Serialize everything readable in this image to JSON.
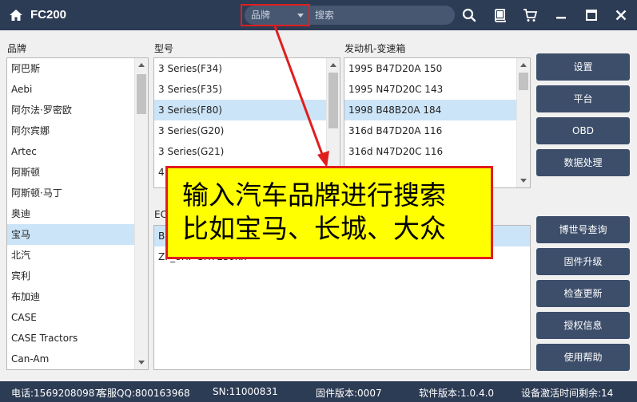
{
  "app": {
    "title": "FC200"
  },
  "search": {
    "brand_dropdown": "品牌",
    "placeholder": "搜索"
  },
  "panels": {
    "brand": {
      "label": "品牌",
      "items": [
        "阿巴斯",
        "Aebi",
        "阿尔法·罗密欧",
        "阿尔宾娜",
        "Artec",
        "阿斯顿",
        "阿斯顿·马丁",
        "奥迪",
        "宝马",
        "北汽",
        "宾利",
        "布加迪",
        "CASE",
        "CASE Tractors",
        "Can-Am"
      ],
      "selected_index": 8
    },
    "model": {
      "label": "型号",
      "items": [
        "3 Series(F34)",
        "3 Series(F35)",
        "3 Series(F80)",
        "3 Series(G20)",
        "3 Series(G21)",
        "4",
        "4"
      ],
      "selected_index": 2
    },
    "engine": {
      "label": "发动机-变速箱",
      "items": [
        "1995 B47D20A 150",
        "1995 N47D20C 143",
        "1998 B48B20A 184",
        "316d B47D20A 116",
        "316d N47D20C 116"
      ],
      "selected_index": 2
    },
    "ecu": {
      "label": "EC",
      "items": [
        "B",
        "ZF_8HP-SH7259xx"
      ],
      "selected_index": 0
    }
  },
  "side_buttons_top": [
    "设置",
    "平台",
    "OBD",
    "数据处理"
  ],
  "side_buttons_bottom": [
    "博世号查询",
    "固件升级",
    "检查更新",
    "授权信息",
    "使用帮助"
  ],
  "status": {
    "phone": "电话:15692080987",
    "qq": "客服QQ:800163968",
    "sn": "SN:11000831",
    "firmware": "固件版本:0007",
    "software": "软件版本:1.0.4.0",
    "activation": "设备激活时间剩余:14"
  },
  "annotation": {
    "line1": "输入汽车品牌进行搜索",
    "line2": "比如宝马、长城、大众"
  },
  "colors": {
    "titlebar": "#2d3c55",
    "button": "#3d4e6b",
    "selected": "#cce4f7",
    "callout_bg": "#ffff00",
    "callout_border": "#e01e1e"
  }
}
